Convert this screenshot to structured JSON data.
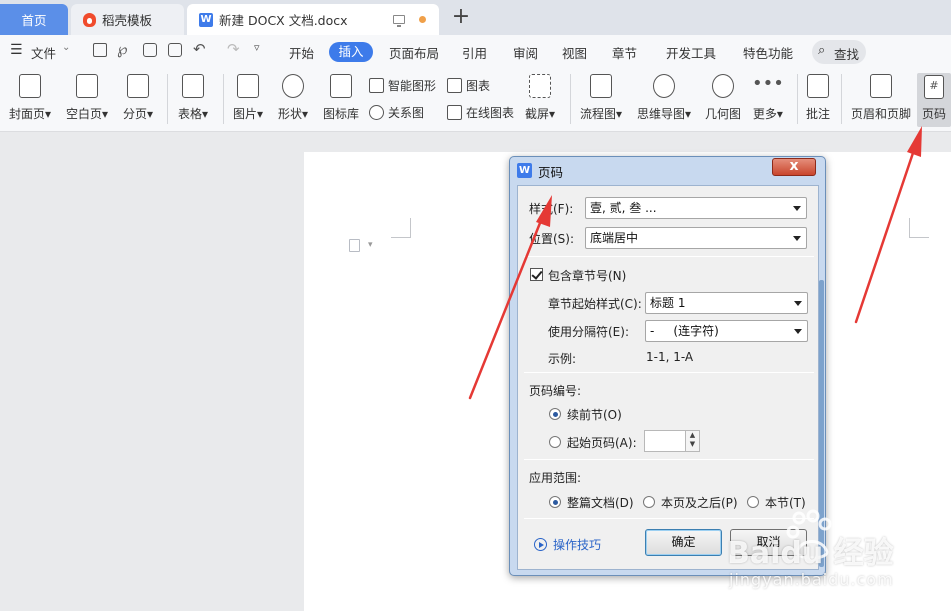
{
  "tabs": {
    "home": "首页",
    "daoke": "稻壳模板",
    "doc": "新建 DOCX 文档.docx",
    "add": "+"
  },
  "menu": {
    "file": "文件",
    "items": [
      "开始",
      "插入",
      "页面布局",
      "引用",
      "审阅",
      "视图",
      "章节",
      "开发工具",
      "特色功能"
    ],
    "active": "插入",
    "search": "查找"
  },
  "ribbon": {
    "cover": "封面页",
    "blank": "空白页",
    "break": "分页",
    "table": "表格",
    "picture": "图片",
    "shape": "形状",
    "iconlib": "图标库",
    "smartart": "智能图形",
    "chart": "图表",
    "relation": "关系图",
    "online_chart": "在线图表",
    "screenshot": "截屏",
    "flowchart": "流程图",
    "mindmap": "思维导图",
    "geometry": "几何图",
    "more": "更多",
    "comment": "批注",
    "header_footer": "页眉和页脚",
    "page_number": "页码"
  },
  "dialog": {
    "title": "页码",
    "close": "x",
    "style_label": "样式(F):",
    "style_value": "壹, 贰, 叁 ...",
    "position_label": "位置(S):",
    "position_value": "底端居中",
    "include_chapter": "包含章节号(N)",
    "chapter_start_label": "章节起始样式(C):",
    "chapter_start_value": "标题 1",
    "separator_label": "使用分隔符(E):",
    "separator_value": "-     (连字符)",
    "example_label": "示例:",
    "example_value": "1-1, 1-A",
    "numbering_title": "页码编号:",
    "continue_prev": "续前节(O)",
    "start_at": "起始页码(A):",
    "scope_title": "应用范围:",
    "whole_doc": "整篇文档(D)",
    "this_and_after": "本页及之后(P)",
    "this_section": "本节(T)",
    "tips": "操作技巧",
    "ok": "确定",
    "cancel": "取消"
  },
  "watermark": {
    "brand": "Baidu 经验",
    "url": "jingyan.baidu.com"
  },
  "colors": {
    "accent": "#3d7bea",
    "arrow": "#e53935",
    "dialog_frame": "#c8d9ef"
  }
}
